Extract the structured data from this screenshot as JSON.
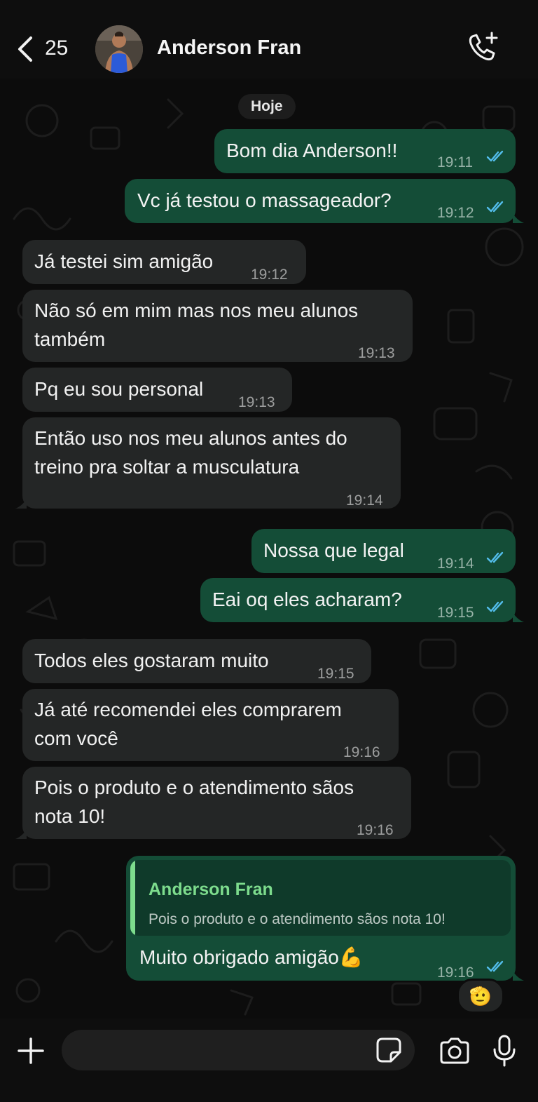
{
  "header": {
    "back_count": "25",
    "contact_name": "Anderson Fran"
  },
  "icons": {
    "back": "chevron-left-icon",
    "call": "phone-add-icon",
    "plus": "plus-icon",
    "sticker": "sticker-icon",
    "camera": "camera-icon",
    "mic": "microphone-icon"
  },
  "colors": {
    "outgoing_bubble": "#144d37",
    "incoming_bubble": "#242626",
    "read_ticks": "#53bdeb",
    "quote_accent": "#7ddc8d"
  },
  "chat": {
    "date_label": "Hoje",
    "messages": [
      {
        "dir": "out",
        "text": "Bom dia Anderson!!",
        "time": "19:11",
        "status": "read"
      },
      {
        "dir": "out",
        "text": "Vc já testou o massageador?",
        "time": "19:12",
        "status": "read"
      },
      {
        "dir": "in",
        "text": "Já testei sim amigão",
        "time": "19:12"
      },
      {
        "dir": "in",
        "text": "Não só em mim mas nos meu alunos\ntambém",
        "time": "19:13"
      },
      {
        "dir": "in",
        "text": "Pq eu sou personal",
        "time": "19:13"
      },
      {
        "dir": "in",
        "text": "Então uso nos meu alunos antes do\ntreino pra soltar a musculatura",
        "time": "19:14"
      },
      {
        "dir": "out",
        "text": "Nossa que legal",
        "time": "19:14",
        "status": "read"
      },
      {
        "dir": "out",
        "text": "Eai oq eles acharam?",
        "time": "19:15",
        "status": "read"
      },
      {
        "dir": "in",
        "text": "Todos eles gostaram muito",
        "time": "19:15"
      },
      {
        "dir": "in",
        "text": "Já até recomendei eles comprarem\ncom você",
        "time": "19:16"
      },
      {
        "dir": "in",
        "text": "Pois o produto e o atendimento sãos\nnota 10!",
        "time": "19:16"
      },
      {
        "dir": "out",
        "text": "Muito obrigado amigão💪",
        "time": "19:16",
        "status": "read",
        "quote": {
          "author": "Anderson Fran",
          "text": "Pois o produto e o atendimento sãos nota 10!"
        },
        "reaction": "🫡"
      }
    ]
  }
}
